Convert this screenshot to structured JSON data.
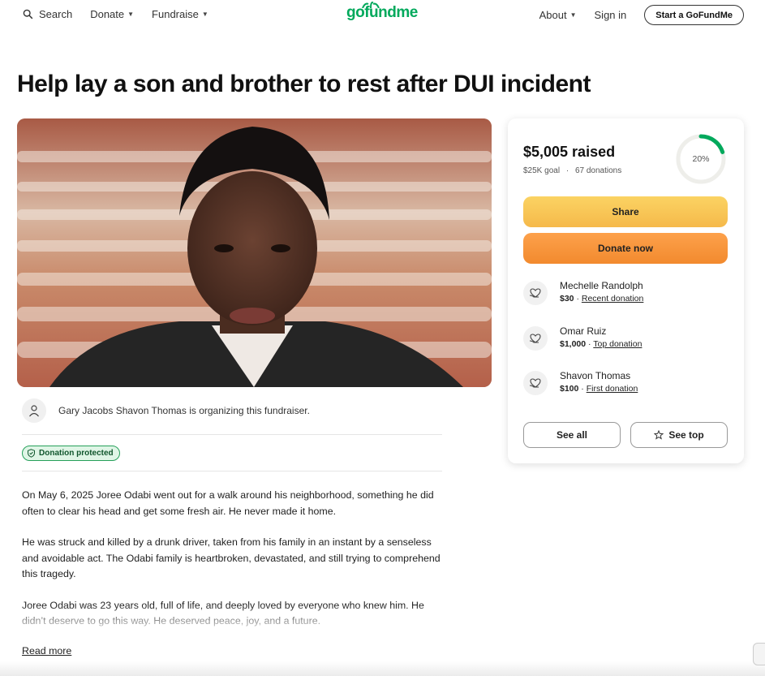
{
  "header": {
    "search_label": "Search",
    "donate_label": "Donate",
    "fundraise_label": "Fundraise",
    "logo_text": "gofundme",
    "about_label": "About",
    "signin_label": "Sign in",
    "start_label": "Start a GoFundMe"
  },
  "campaign": {
    "title": "Help lay a son and brother to rest after DUI incident",
    "organizer_text": "Gary Jacobs Shavon Thomas is organizing this fundraiser.",
    "protected_label": "Donation protected",
    "story": [
      "On May 6, 2025 Joree Odabi went out for a walk around his neighborhood, something he did often to clear his head and get some fresh air. He never made it home.",
      "He was struck and killed by a drunk driver, taken from his family in an instant by a senseless and avoidable act. The Odabi family is heartbroken, devastated, and still trying to comprehend this tragedy.",
      "Joree Odabi was 23 years old, full of life, and deeply loved by everyone who knew him. He didn’t deserve to go this way. He deserved peace, joy, and a future."
    ],
    "read_more_label": "Read more"
  },
  "donation_card": {
    "raised": "$5,005 raised",
    "goal": "$25K goal",
    "separator": "·",
    "donations_count": "67 donations",
    "progress_label": "20%",
    "progress_fraction": 0.2,
    "share_label": "Share",
    "donate_label": "Donate now",
    "donations": [
      {
        "name": "Mechelle Randolph",
        "amount": "$30",
        "tag": "Recent donation"
      },
      {
        "name": "Omar Ruiz",
        "amount": "$1,000",
        "tag": "Top donation"
      },
      {
        "name": "Shavon Thomas",
        "amount": "$100",
        "tag": "First donation"
      }
    ],
    "see_all_label": "See all",
    "see_top_label": "See top"
  },
  "colors": {
    "brand": "#02a95c",
    "share_button": "#f9c653",
    "donate_button": "#f7963c",
    "protected_bg": "#dff5e6"
  },
  "icons": [
    "search-icon",
    "caret-down-icon",
    "user-icon",
    "shield-check-icon",
    "donor-heart-icon",
    "star-icon"
  ]
}
